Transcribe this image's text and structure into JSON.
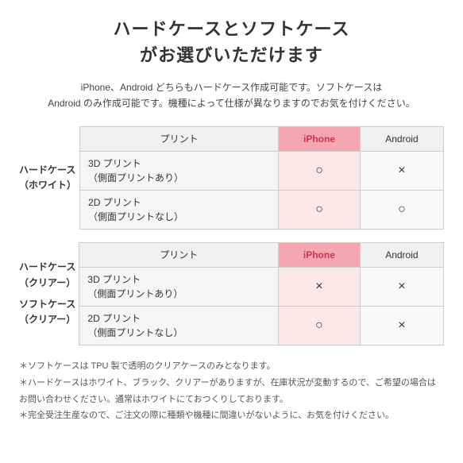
{
  "title_line1": "ハードケースとソフトケース",
  "title_line2": "がお選びいただけます",
  "subtitle": "iPhone、Android どちらもハードケース作成可能です。ソフトケースは\nAndroid のみ作成可能です。機種によって仕様が異なりますのでお気を付けください。",
  "table1": {
    "row_label_line1": "ハードケース",
    "row_label_line2": "（ホワイト）",
    "col_print": "プリント",
    "col_iphone": "iPhone",
    "col_android": "Android",
    "rows": [
      {
        "print": "3D プリント\n（側面プリントあり）",
        "iphone": "○",
        "android": "×"
      },
      {
        "print": "2D プリント\n（側面プリントなし）",
        "iphone": "○",
        "android": "○"
      }
    ]
  },
  "table2": {
    "row_label_line1": "ハードケース",
    "row_label_line2": "（クリアー）",
    "row_label2_line1": "ソフトケース",
    "row_label2_line2": "（クリアー）",
    "col_print": "プリント",
    "col_iphone": "iPhone",
    "col_android": "Android",
    "rows": [
      {
        "print": "3D プリント\n（側面プリントあり）",
        "iphone": "×",
        "android": "×"
      },
      {
        "print": "2D プリント\n（側面プリントなし）",
        "iphone": "○",
        "android": "×"
      }
    ]
  },
  "notes": [
    "ソフトケースは TPU 製で透明のクリアケースのみとなります。",
    "ハードケースはホワイト、ブラック、クリアーがありますが、在庫状況が変動するので、ご希望の場合はお問い合わせください。通常はホワイトにておつくりしております。",
    "完全受注生産なので、ご注文の際に種類や機種に間違いがないように、お気を付けください。"
  ]
}
